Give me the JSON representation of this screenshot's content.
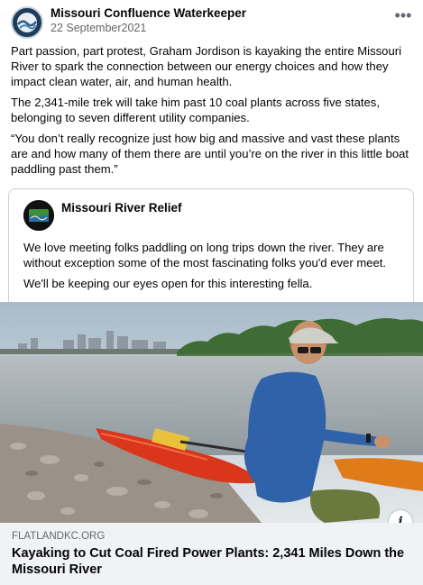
{
  "post": {
    "page_name": "Missouri Confluence Waterkeeper",
    "date": "22 September2021",
    "more_icon": "ellipsis-icon",
    "paragraphs": [
      "Part passion, part protest, Graham Jordison is kayaking the entire Missouri River to spark the connection between our energy choices and how they impact clean water, air, and human health.",
      "The 2,341-mile trek will take him past 10 coal plants across five states, belonging to seven different utility companies.",
      "“You don’t really recognize just how big and massive and vast these plants are and how many of them there are until you’re on the river in this little boat paddling past them.”"
    ]
  },
  "shared_post": {
    "page_name": "Missouri River Relief",
    "paragraphs": [
      "We love meeting folks paddling on long trips down the river. They are without exception some of the most fascinating folks you'd ever meet.",
      "We'll be keeping our eyes open for this interesting fella."
    ]
  },
  "link_preview": {
    "domain": "FLATLANDKC.ORG",
    "title": "Kayaking to Cut Coal Fired Power Plants: 2,341 Miles Down the Missouri River",
    "info_icon": "info-icon"
  },
  "colors": {
    "kayak": "#d9361b",
    "water": "#9aa4a8",
    "sky": "#d8e2ea"
  }
}
